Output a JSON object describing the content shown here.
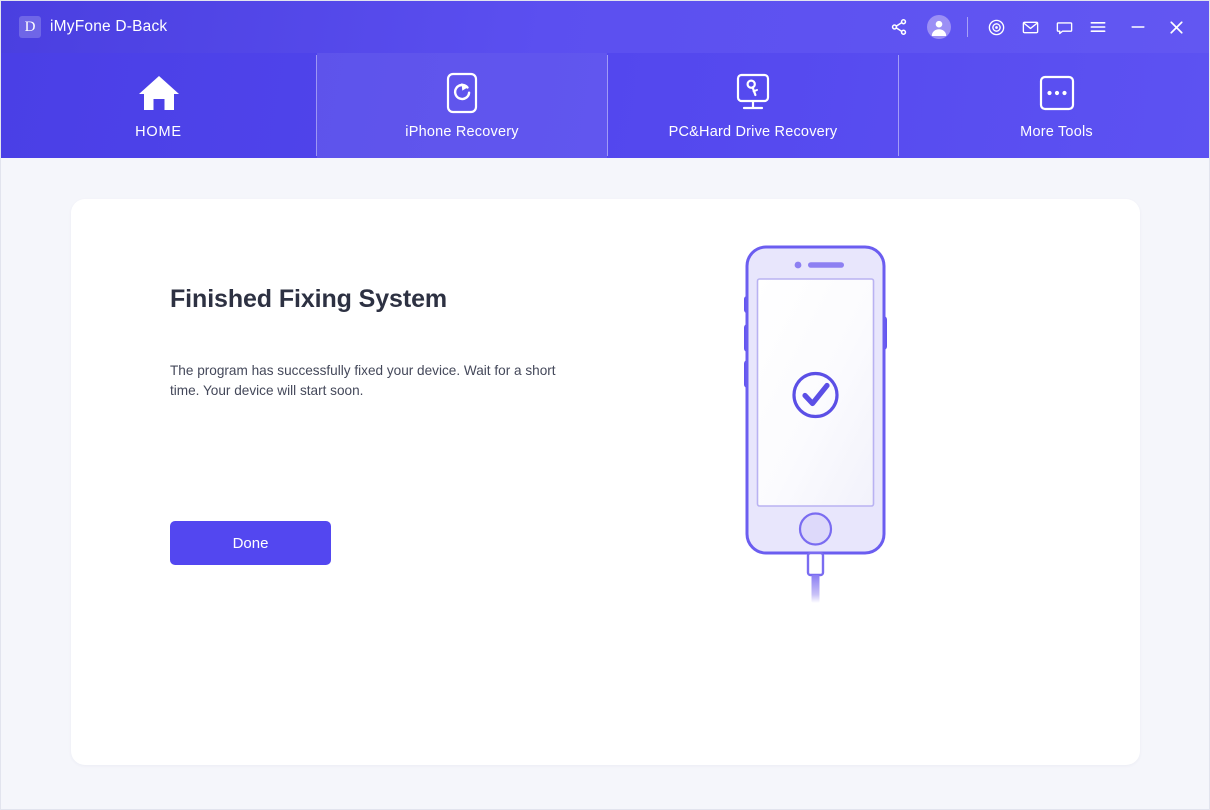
{
  "window": {
    "title": "iMyFone D-Back",
    "logo_letter": "D",
    "background_color": "#f5f6fb",
    "accent_color": "#5347f0"
  },
  "titlebar": {
    "actions": [
      {
        "name": "share-icon",
        "label": "Share"
      },
      {
        "name": "account-avatar-icon",
        "label": "Account"
      },
      {
        "name": "divider",
        "label": ""
      },
      {
        "name": "target-icon",
        "label": "Registration"
      },
      {
        "name": "mail-icon",
        "label": "Email Support"
      },
      {
        "name": "chat-icon",
        "label": "Feedback"
      },
      {
        "name": "menu-icon",
        "label": "Menu"
      },
      {
        "name": "minimize-icon",
        "label": "Minimize"
      },
      {
        "name": "close-icon",
        "label": "Close"
      }
    ]
  },
  "nav": {
    "tabs": [
      {
        "label": "HOME",
        "icon": "home-icon",
        "active": false
      },
      {
        "label": "iPhone Recovery",
        "icon": "phone-refresh-icon",
        "active": true
      },
      {
        "label": "PC&Hard Drive Recovery",
        "icon": "monitor-key-icon",
        "active": false
      },
      {
        "label": "More Tools",
        "icon": "ellipsis-icon",
        "active": false
      }
    ]
  },
  "main": {
    "title": "Finished Fixing System",
    "description": "The program has successfully fixed your device. Wait for a short time. Your device will start soon.",
    "done_label": "Done",
    "illustration": {
      "name": "iphone-with-checkmark-illustration",
      "status_icon": "check-circle-icon",
      "body_color": "#e6e4fb",
      "outline_color": "#6b5df0",
      "screen_color": "#ffffff"
    }
  }
}
